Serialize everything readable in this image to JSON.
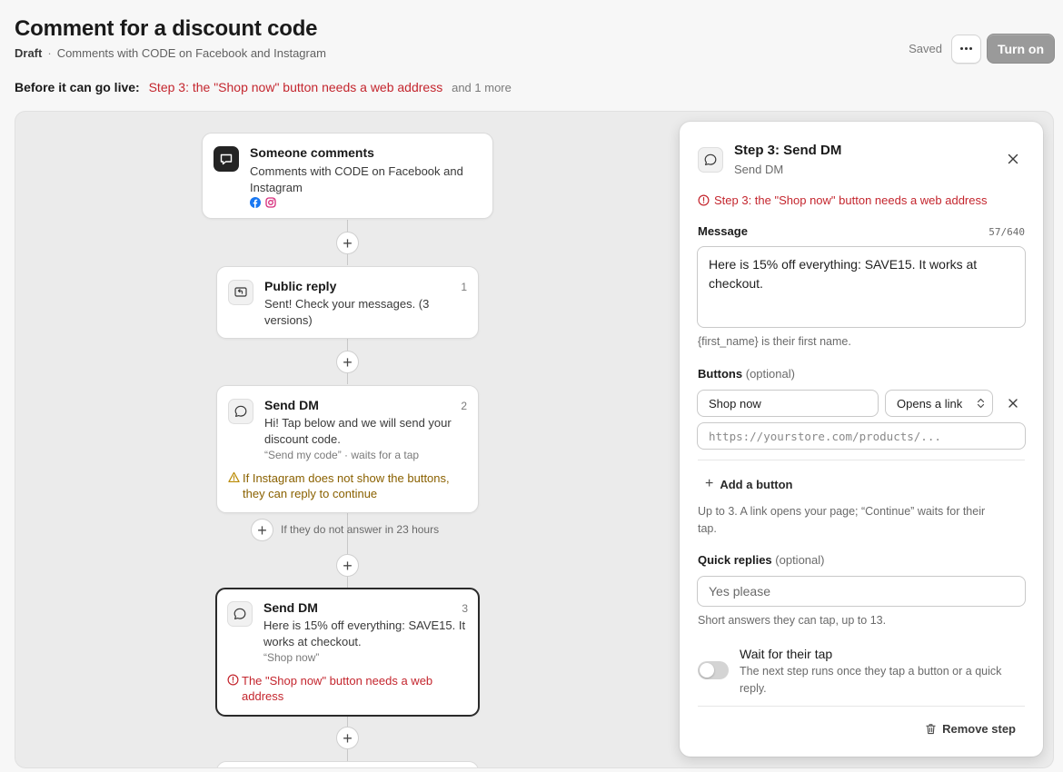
{
  "header": {
    "title": "Comment for a discount code",
    "status": "Draft",
    "separator": "·",
    "subtitle": "Comments with CODE on Facebook and Instagram",
    "saved_label": "Saved",
    "turn_on_label": "Turn on"
  },
  "go_live": {
    "label": "Before it can go live:",
    "error": "Step 3: the \"Shop now\" button needs a web address",
    "more": "and 1 more"
  },
  "flow": {
    "trigger": {
      "title": "Someone comments",
      "body": "Comments with CODE on Facebook and Instagram",
      "icon": "comment-icon",
      "platforms": [
        "facebook-icon",
        "instagram-icon"
      ]
    },
    "steps": [
      {
        "title": "Public reply",
        "number": "1",
        "body": "Sent! Check your messages. (3 versions)",
        "icon": "reply-icon"
      },
      {
        "title": "Send DM",
        "number": "2",
        "body": "Hi! Tap below and we will send your discount code.",
        "meta": "“Send my code” · waits for a tap",
        "warning": "If Instagram does not show the buttons, they can reply to continue",
        "icon": "chat-bubble-icon"
      },
      {
        "title": "Send DM",
        "number": "3",
        "body": "Here is 15% off everything: SAVE15. It works at checkout.",
        "meta": "“Shop now”",
        "error": "The \"Shop now\" button needs a web address",
        "icon": "chat-bubble-icon"
      }
    ],
    "timeout_label": "If they do not answer in 23 hours"
  },
  "panel": {
    "title": "Step 3: Send DM",
    "subtitle": "Send DM",
    "error": "Step 3: the \"Shop now\" button needs a web address",
    "message_label": "Message",
    "message_counter": "57/640",
    "message_value": "Here is 15% off everything: SAVE15. It works at checkout.",
    "message_hint": "{first_name} is their first name.",
    "buttons_label": "Buttons",
    "optional": "(optional)",
    "button_name": "Shop now",
    "button_action": "Opens a link",
    "url_placeholder": "https://yourstore.com/products/...",
    "add_button_label": "Add a button",
    "buttons_hint": "Up to 3. A link opens your page; “Continue” waits for their tap.",
    "quick_replies_label": "Quick replies",
    "quick_reply_placeholder": "Yes please",
    "quick_replies_hint": "Short answers they can tap, up to 13.",
    "wait_title": "Wait for their tap",
    "wait_desc": "The next step runs once they tap a button or a quick reply.",
    "wait_enabled": false,
    "remove_label": "Remove step"
  },
  "colors": {
    "error": "#c4262e",
    "warning": "#8a6100",
    "warning_icon": "#b98900",
    "facebook": "#1877f2",
    "instagram": "#d6297a"
  }
}
